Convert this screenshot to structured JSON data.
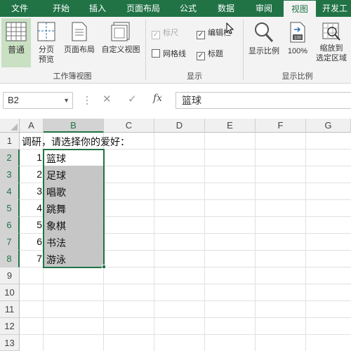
{
  "tabs": [
    {
      "label": "文件",
      "active": false
    },
    {
      "label": "开始",
      "active": false
    },
    {
      "label": "插入",
      "active": false
    },
    {
      "label": "页面布局",
      "active": false
    },
    {
      "label": "公式",
      "active": false
    },
    {
      "label": "数据",
      "active": false
    },
    {
      "label": "审阅",
      "active": false
    },
    {
      "label": "视图",
      "active": true
    },
    {
      "label": "开发工",
      "active": false
    }
  ],
  "ribbon": {
    "workbook_views": {
      "label": "工作簿视图",
      "normal": "普通",
      "page_break_preview": [
        "分页",
        "预览"
      ],
      "page_layout": "页面布局",
      "custom_views": "自定义视图"
    },
    "show": {
      "label": "显示",
      "ruler": "标尺",
      "edit_bar": "编辑栏",
      "gridlines": "网格线",
      "headings": "标题"
    },
    "zoom": {
      "label": "显示比例",
      "zoom": "显示比例",
      "zoom_100": "100%",
      "zoom_to_selection": [
        "缩放到",
        "选定区域"
      ]
    }
  },
  "formula_bar": {
    "name_box": "B2",
    "cancel": "✕",
    "enter": "✓",
    "fx": "fx",
    "content": "篮球"
  },
  "columns": [
    "A",
    "B",
    "C",
    "D",
    "E",
    "F",
    "G"
  ],
  "rows": [
    "1",
    "2",
    "3",
    "4",
    "5",
    "6",
    "7",
    "8",
    "9",
    "10",
    "11",
    "12",
    "13"
  ],
  "sheet": {
    "a1": "调研，请选择你的爱好：",
    "items": [
      {
        "num": "1",
        "text": "篮球"
      },
      {
        "num": "2",
        "text": "足球"
      },
      {
        "num": "3",
        "text": "唱歌"
      },
      {
        "num": "4",
        "text": "跳舞"
      },
      {
        "num": "5",
        "text": "象棋"
      },
      {
        "num": "6",
        "text": "书法"
      },
      {
        "num": "7",
        "text": "游泳"
      }
    ]
  },
  "colors": {
    "accent": "#217346",
    "selection": "#c6c6c6"
  }
}
